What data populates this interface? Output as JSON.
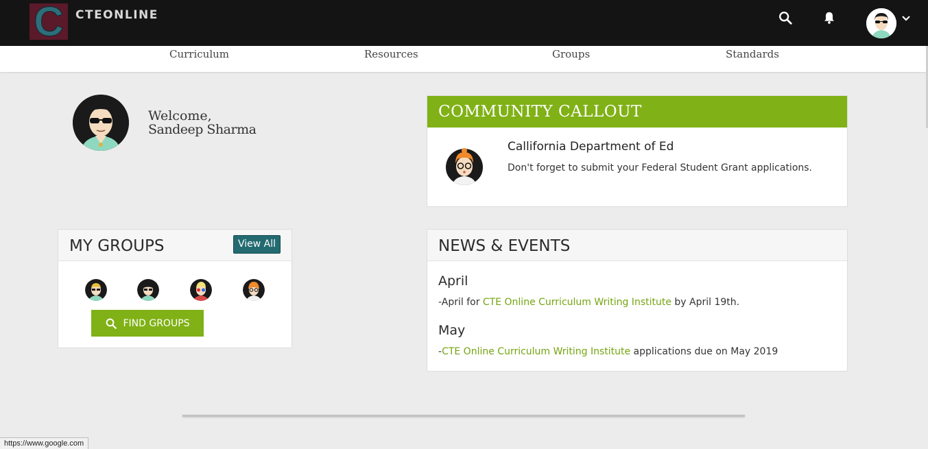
{
  "header": {
    "logo_letter": "C",
    "brand": "CTEONLINE",
    "icons": [
      "search-icon",
      "bell-icon",
      "user-avatar",
      "chevron-down-icon"
    ]
  },
  "nav": {
    "items": [
      "Curriculum",
      "Resources",
      "Groups",
      "Standards"
    ]
  },
  "welcome": {
    "label": "Welcome,",
    "name": "Sandeep Sharma"
  },
  "community_callout": {
    "title": "COMMUNITY CALLOUT",
    "org": "Callifornia Department of Ed",
    "message": "Don't forget to submit your Federal Student Grant applications."
  },
  "my_groups": {
    "title": "MY GROUPS",
    "view_all": "View All",
    "find_groups": "FIND GROUPS"
  },
  "news_events": {
    "title": "NEWS & EVENTS",
    "items": [
      {
        "month": "April",
        "prefix": "-April for ",
        "link": "CTE Online Curriculum Writing Institute",
        "suffix": " by April 19th."
      },
      {
        "month": "May",
        "prefix": "-",
        "link": "CTE Online Curriculum Writing Institute",
        "suffix": " applications due on May 2019"
      }
    ]
  },
  "status_bar": {
    "url": "https://www.google.com"
  },
  "colors": {
    "accent_green": "#80b116",
    "link_green": "#74a410",
    "teal_button": "#236b71",
    "topbar": "#141414"
  }
}
